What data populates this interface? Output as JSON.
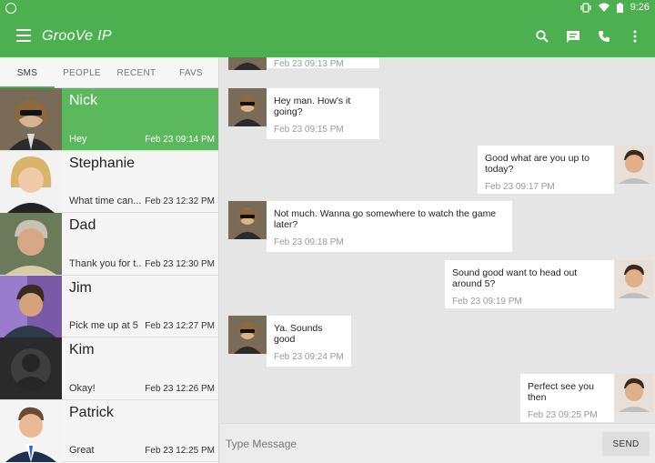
{
  "status": {
    "time": "9:26"
  },
  "app": {
    "title": "GrooVe IP"
  },
  "tabs": [
    {
      "label": "SMS",
      "active": true
    },
    {
      "label": "PEOPLE",
      "active": false
    },
    {
      "label": "RECENT",
      "active": false
    },
    {
      "label": "FAVS",
      "active": false
    }
  ],
  "contacts": [
    {
      "name": "Nick",
      "preview": "Hey",
      "time": "Feb 23 09:14 PM",
      "selected": true
    },
    {
      "name": "Stephanie",
      "preview": "What time can...",
      "time": "Feb 23 12:32 PM",
      "selected": false
    },
    {
      "name": "Dad",
      "preview": "Thank you for t...",
      "time": "Feb 23 12:30 PM",
      "selected": false
    },
    {
      "name": "Jim",
      "preview": "Pick me up at 5",
      "time": "Feb 23 12:27 PM",
      "selected": false
    },
    {
      "name": "Kim",
      "preview": "Okay!",
      "time": "Feb 23 12:26 PM",
      "selected": false
    },
    {
      "name": "Patrick",
      "preview": "Great",
      "time": "Feb 23 12:25 PM",
      "selected": false
    }
  ],
  "messages": [
    {
      "side": "in",
      "text": "",
      "time": "Feb 23 09:13 PM"
    },
    {
      "side": "in",
      "text": "Hey man. How's it going?",
      "time": "Feb 23 09:15 PM"
    },
    {
      "side": "out",
      "text": "Good what are you up to today?",
      "time": "Feb 23 09:17 PM"
    },
    {
      "side": "in",
      "text": "Not much. Wanna go somewhere to watch the game later?",
      "time": "Feb 23 09:18 PM"
    },
    {
      "side": "out",
      "text": "Sound good want to head out around 5?",
      "time": "Feb 23 09:19 PM"
    },
    {
      "side": "in",
      "text": "Ya. Sounds good",
      "time": "Feb 23 09:24 PM"
    },
    {
      "side": "out",
      "text": "Perfect see you then",
      "time": "Feb 23 09:25 PM"
    }
  ],
  "composer": {
    "placeholder": "Type Message",
    "send_label": "SEND"
  },
  "colors": {
    "primary": "#4caf50",
    "selected": "#5cb85c"
  }
}
